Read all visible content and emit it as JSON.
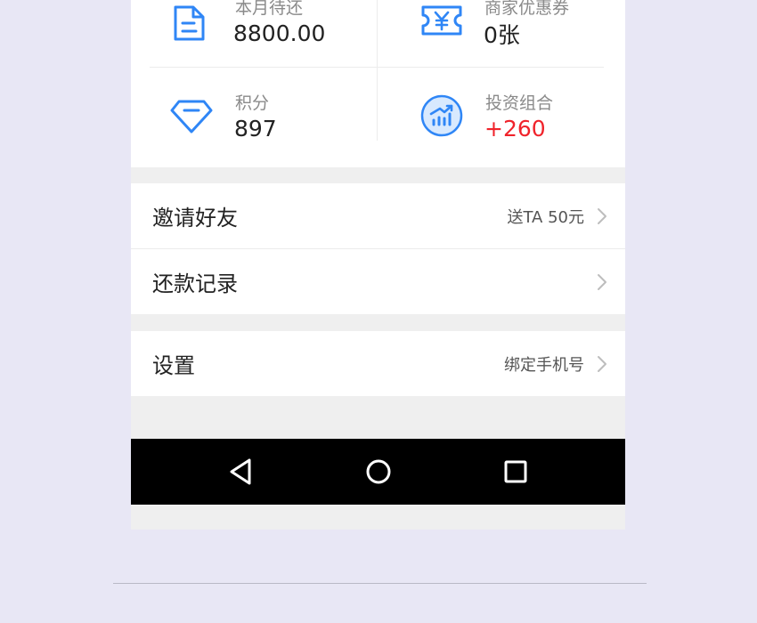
{
  "stats": {
    "monthly_due": {
      "label": "本月待还",
      "value": "8800.00",
      "icon": "document-icon"
    },
    "coupons": {
      "label": "商家优惠券",
      "value": "0张",
      "icon": "yuan-ticket-icon"
    },
    "points": {
      "label": "积分",
      "value": "897",
      "icon": "diamond-icon"
    },
    "portfolio": {
      "label": "投资组合",
      "value": "+260",
      "icon": "growth-chart-icon"
    }
  },
  "menu": {
    "invite": {
      "title": "邀请好友",
      "extra": "送TA 50元"
    },
    "repayment": {
      "title": "还款记录"
    },
    "settings": {
      "title": "设置",
      "extra": "绑定手机号"
    }
  },
  "colors": {
    "accent": "#2f86f6",
    "positive": "#f0232b",
    "navbar": "#000000"
  },
  "navbar": {
    "icons": [
      "back-icon",
      "home-icon",
      "recents-icon"
    ]
  }
}
